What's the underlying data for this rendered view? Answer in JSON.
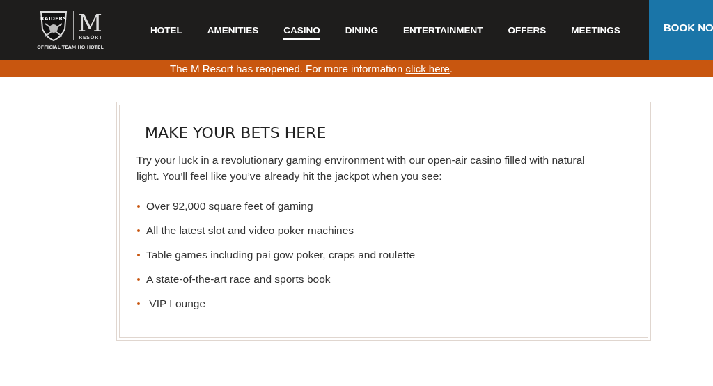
{
  "header": {
    "logo": {
      "team": "RAIDERS",
      "mark": "M",
      "resort": "RESORT",
      "tagline": "OFFICIAL TEAM HQ HOTEL"
    },
    "nav": [
      {
        "label": "HOTEL",
        "selected": false
      },
      {
        "label": "AMENITIES",
        "selected": false
      },
      {
        "label": "CASINO",
        "selected": true
      },
      {
        "label": "DINING",
        "selected": false
      },
      {
        "label": "ENTERTAINMENT",
        "selected": false
      },
      {
        "label": "OFFERS",
        "selected": false
      },
      {
        "label": "MEETINGS",
        "selected": false
      }
    ],
    "book_button": "BOOK NO"
  },
  "announcement": {
    "text": "The M Resort has reopened. For more information ",
    "link": "click here",
    "end": "."
  },
  "content": {
    "heading": "MAKE YOUR BETS HERE",
    "intro": "Try your luck in a revolutionary gaming environment with our open-air casino filled with natural light. You’ll feel like you’ve already hit the jackpot when you see:",
    "items": [
      "Over 92,000 square feet of gaming",
      "All the latest slot and video poker machines",
      "Table games including pai gow poker, craps and roulette",
      "A state-of-the-art race and sports book",
      " VIP Lounge"
    ]
  }
}
